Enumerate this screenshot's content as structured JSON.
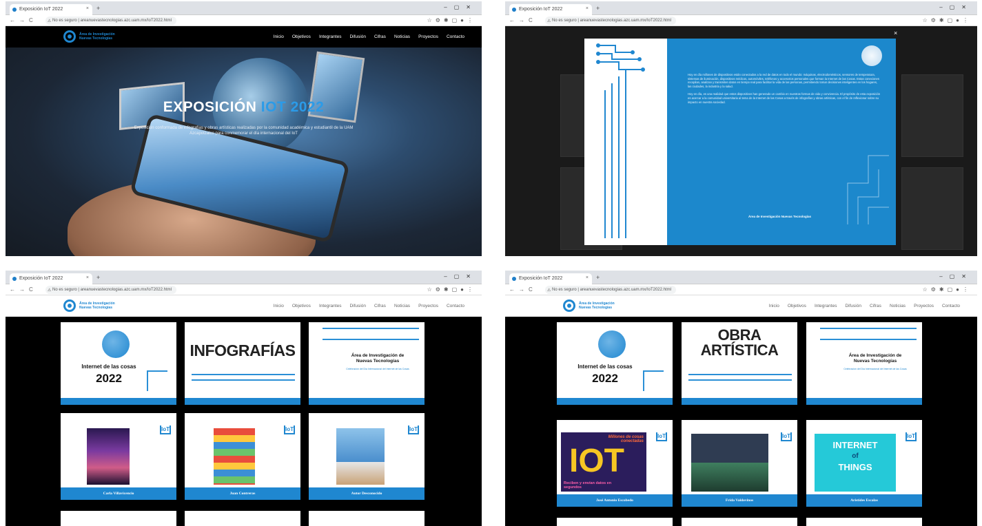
{
  "browser": {
    "tab_title": "Exposición IoT 2022",
    "tab_close": "×",
    "new_tab": "+",
    "window_controls": "–▢✕",
    "nav_buttons": "←→C",
    "lock": "⚠",
    "url": "No es seguro | areanuevastecnologias.azc.uam.mx/IoT2022.html",
    "extensions": "☆⚙✱▢●⋮"
  },
  "site": {
    "logo_line1": "Área de Investigación",
    "logo_line2": "Nuevas Tecnologías",
    "menu": [
      "Inicio",
      "Objetivos",
      "Integrantes",
      "Difusión",
      "Cifras",
      "Noticias",
      "Proyectos",
      "Contacto"
    ]
  },
  "hero": {
    "title_main": "EXPOSICIÓN ",
    "title_highlight": "IOT 2022",
    "subtitle": "Exposición conformada de infografías y obras artísticas realizadas por la comunidad académica y estudiantil de la UAM Azcapotzalco para conmemorar el día internacional del IoT"
  },
  "modal": {
    "close": "×",
    "paragraph1": "Hoy en día millones de dispositivos están conectados a la red de datos en todo el mundo: máquinas, electrodomésticos, sensores de temperatura, sistemas de iluminación, dispositivos médicos, automóviles, teléfonos y accesorios personales que forman la Internet de las Cosas. Estas conexiones recopilan, analizan y transmiten datos en tiempo real para facilitar la vida de las personas, permitiendo tomar decisiones inteligentes en los hogares, las ciudades, la industria y la salud.",
    "paragraph2": "Hoy en día, es una realidad que estos dispositivos han generado un cambio en nuestras formas de vida y convivencia. El propósito de esta exposición es acercar a la comunidad universitaria al tema de la Internet de las Cosas a través de infografías y obras artísticas, con el fin de reflexionar sobre su impacto en nuestra sociedad.",
    "signature": "Área de Investigación Nuevas Tecnologías"
  },
  "gallery_common": {
    "iot_title": "Internet de las cosas",
    "iot_year": "2022",
    "area_title_line1": "Área de Investigación de",
    "area_title_line2": "Nuevas Tecnologías",
    "area_subtitle": "Celebración del Día Internacional del Internet de las Cosas"
  },
  "gallery_infografias": {
    "banner_line1": "INFOGRAFÍAS",
    "banner_line2": "",
    "people": [
      "Carla Villavicencio",
      "Juan Contreras",
      "Autor Desconocido"
    ]
  },
  "gallery_obra": {
    "banner_line1": "OBRA",
    "banner_line2": "ARTÍSTICA",
    "people": [
      "José Antonio Escobedo",
      "Frida Valdovinos",
      "Aristides Escalas"
    ],
    "art1_text": "Millones de cosas conectadas",
    "art1_big": "IOT",
    "art1_bottom": "Reciben y envían datos en segundos",
    "art3_line1": "INTERNET",
    "art3_line2": "of",
    "art3_line3": "THINGS"
  },
  "colors": {
    "accent": "#1f87d0",
    "highlight": "#2b9be8",
    "header_black": "#000000"
  }
}
